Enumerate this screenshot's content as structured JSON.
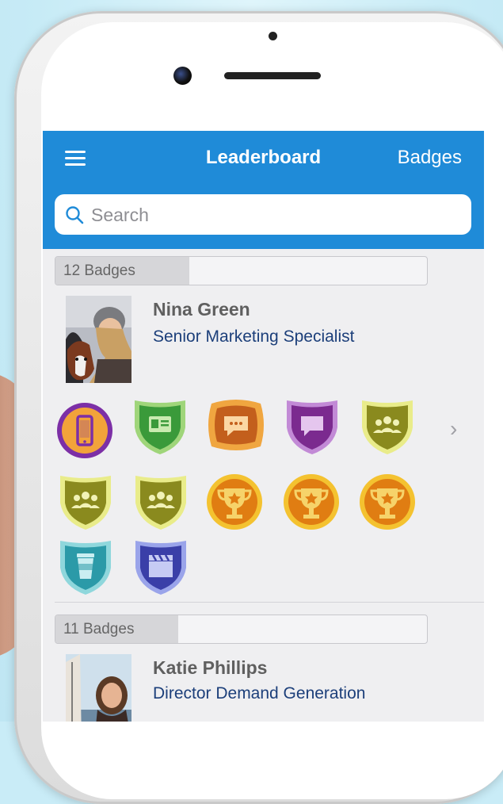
{
  "header": {
    "title": "Leaderboard",
    "right_action": "Badges",
    "menu_icon": "hamburger-icon"
  },
  "search": {
    "placeholder": "Search",
    "value": "",
    "icon": "search-icon"
  },
  "colors": {
    "nav_bg": "#1f8bd8",
    "screen_bg": "#efeff1",
    "title_text": "#1c3f7a",
    "name_text": "#5f5f5f"
  },
  "leaderboard": [
    {
      "badge_count_label": "12 Badges",
      "badge_progress": 0.36,
      "name": "Nina Green",
      "title": "Senior Marketing Specialist",
      "badges": [
        "phone-circle-purple",
        "id-card-shield-green",
        "chat-plaque-orange",
        "chat-shield-purple",
        "team-shield-yellow",
        "team-shield-yellow",
        "team-shield-yellow",
        "trophy-medal-orange",
        "trophy-medal-orange",
        "trophy-medal-orange",
        "coffee-shield-teal",
        "clapper-shield-blue"
      ],
      "more_icon": "chevron-right-icon"
    },
    {
      "badge_count_label": "11 Badges",
      "badge_progress": 0.33,
      "name": "Katie Phillips",
      "title": "Director Demand Generation"
    }
  ]
}
